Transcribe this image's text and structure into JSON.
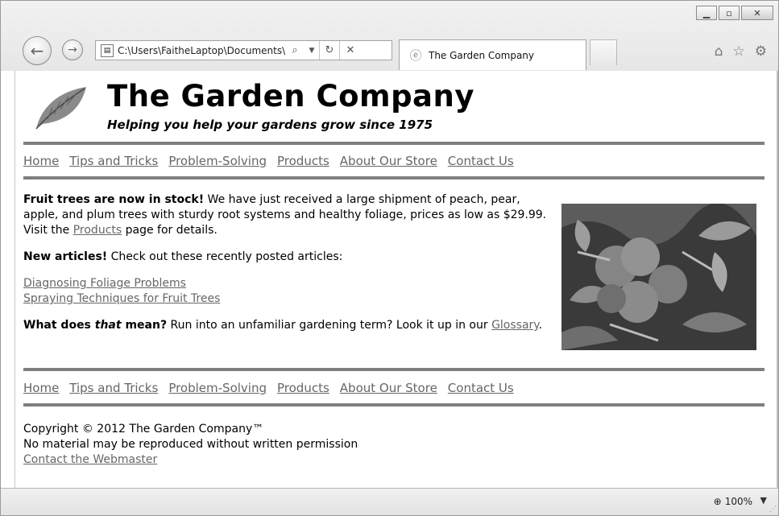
{
  "browser": {
    "address": "C:\\Users\\FaitheLaptop\\Documents\\",
    "tab_title": "The Garden Company",
    "zoom": "100%",
    "window_controls": [
      "minimize-icon",
      "maximize-icon",
      "close-icon"
    ],
    "toolbar_icons": [
      "home-icon",
      "favorites-star-icon",
      "settings-gear-icon"
    ]
  },
  "site": {
    "title": "The Garden Company",
    "tagline": "Helping you help your gardens grow since 1975"
  },
  "nav": [
    "Home",
    "Tips and Tricks",
    "Problem-Solving",
    "Products",
    "About Our Store",
    "Contact Us"
  ],
  "main": {
    "p1_bold": "Fruit trees are now in stock!",
    "p1_text1": " We have just received a large shipment of peach, pear, apple, and plum trees with sturdy root systems and healthy foliage, prices as low as $29.99. Visit the ",
    "p1_link": "Products",
    "p1_text2": " page for details.",
    "p2_bold": "New articles!",
    "p2_text": " Check out these recently posted articles:",
    "articles": [
      "Diagnosing Foliage Problems",
      "Spraying Techniques for Fruit Trees"
    ],
    "p3_bold1": "What does ",
    "p3_italic": "that",
    "p3_bold2": " mean?",
    "p3_text": " Run into an unfamiliar gardening term? Look it up in our ",
    "p3_link": "Glossary",
    "p3_end": "."
  },
  "footer": {
    "copyright": "Copyright © 2012 The Garden Company™",
    "notice": "No material may be reproduced without written permission",
    "contact_link": "Contact the Webmaster"
  },
  "colors": {
    "rule": "#7f7f7f",
    "link": "#666666"
  }
}
